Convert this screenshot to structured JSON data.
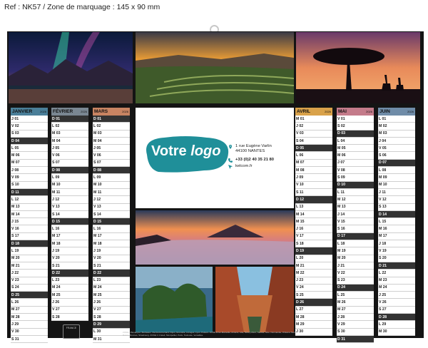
{
  "ref_label": "Ref : NK57 / Zone de marquage : 145 x 90 mm",
  "logo": {
    "text_main": "Votre",
    "text_italic": "logo",
    "color": "#1a8c96"
  },
  "contact": {
    "address_line1": "1 rue Eugène Varlin",
    "address_line2": "44100 NANTES",
    "phone": "+33 (0)2 40 35 21 80",
    "website": "kelcom.fr"
  },
  "year": "2026",
  "months": [
    {
      "name": "JANVIER",
      "color": "#4a7f99",
      "start": 3,
      "days": 31
    },
    {
      "name": "FÉVRIER",
      "color": "#7a8792",
      "start": 6,
      "days": 28
    },
    {
      "name": "MARS",
      "color": "#c88462",
      "start": 6,
      "days": 31
    },
    {
      "name": "AVRIL",
      "color": "#d9a24a",
      "start": 2,
      "days": 30
    },
    {
      "name": "MAI",
      "color": "#c47b8a",
      "start": 4,
      "days": 31
    },
    {
      "name": "JUIN",
      "color": "#6f8ca8",
      "start": 0,
      "days": 30
    }
  ],
  "day_letters": [
    "L",
    "M",
    "M",
    "J",
    "V",
    "S",
    "D"
  ],
  "footer_note": "ZONE A Besançon, Bordeaux, Clermont-Ferrand, Dijon, Grenoble, Limoges, Lyon, Poitiers. ZONE B Aix-Marseille, Amiens, Lille, Nancy-Metz, Nantes, Nice, Normandie, Orléans-Tours, Reims, Rennes, Strasbourg. ZONE C Créteil, Montpellier, Paris, Toulouse, Versailles.",
  "badge_text": "FRANCE"
}
